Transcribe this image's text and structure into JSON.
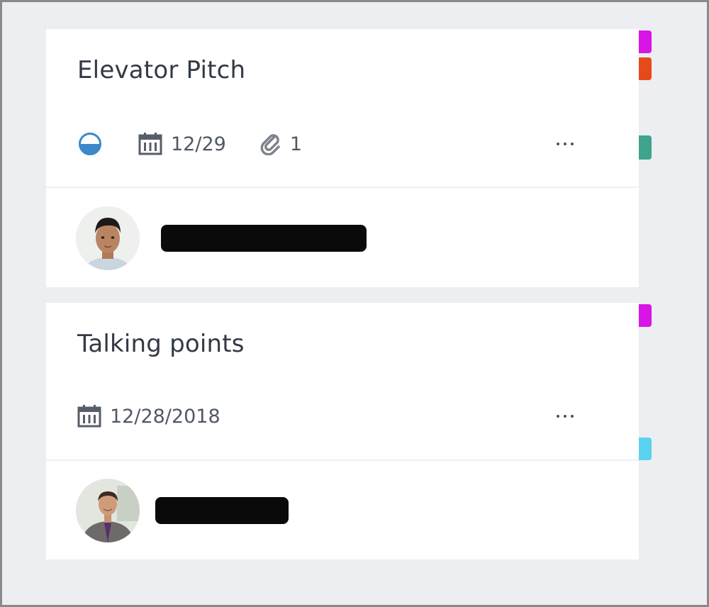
{
  "tasks": [
    {
      "title": "Elevator Pitch",
      "progress": "in-progress-icon",
      "due_date": "12/29",
      "attachment_count": "1",
      "label_colors": [
        "#d914e6",
        "#e64a19",
        "#3fa38d"
      ],
      "assignee": {
        "avatar": "person-avatar-1"
      }
    },
    {
      "title": "Talking points",
      "due_date": "12/28/2018",
      "label_colors": [
        "#d914e6",
        "#59d3ef"
      ],
      "assignee": {
        "avatar": "person-avatar-2"
      }
    }
  ]
}
